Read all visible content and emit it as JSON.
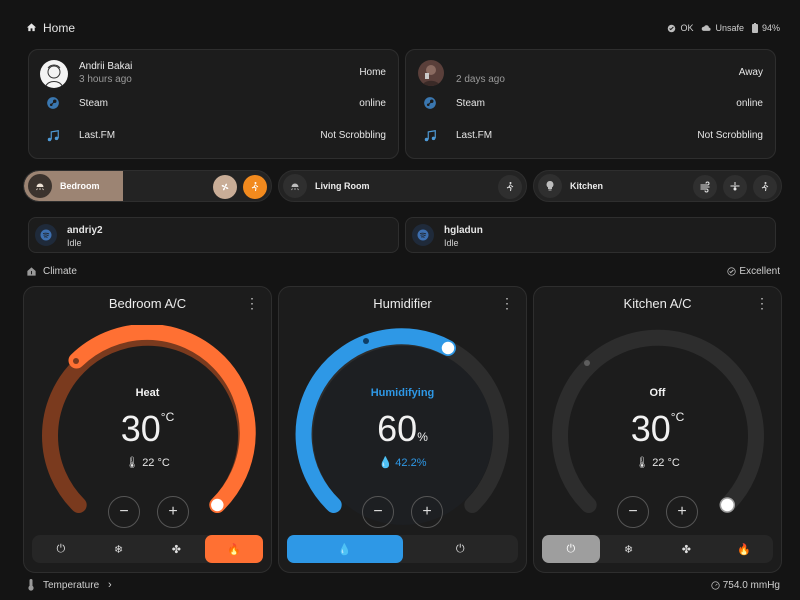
{
  "header": {
    "title": "Home",
    "status_ok": "OK",
    "status_unsafe": "Unsafe",
    "battery": "94%"
  },
  "users": [
    {
      "name": "Andrii Bakai",
      "time": "3 hours ago",
      "location": "Home",
      "steam_label": "Steam",
      "steam_status": "online",
      "lastfm_label": "Last.FM",
      "lastfm_status": "Not Scrobbling"
    },
    {
      "name": "",
      "time": "2 days ago",
      "location": "Away",
      "steam_label": "Steam",
      "steam_status": "online",
      "lastfm_label": "Last.FM",
      "lastfm_status": "Not Scrobbling"
    }
  ],
  "rooms": [
    {
      "label": "Bedroom",
      "brightness_fraction": 0.29,
      "icons": [
        "fan-icon",
        "motion-icon"
      ]
    },
    {
      "label": "Living Room",
      "icons": [
        "motion-icon"
      ]
    },
    {
      "label": "Kitchen",
      "icons": [
        "air-purifier-icon",
        "ceiling-fan-icon",
        "motion-icon"
      ]
    }
  ],
  "spotify": [
    {
      "user": "andriy2",
      "state": "Idle"
    },
    {
      "user": "hgladun",
      "state": "Idle"
    }
  ],
  "climate": {
    "section_label": "Climate",
    "status_label": "Excellent"
  },
  "thermostats": [
    {
      "title": "Bedroom A/C",
      "mode": "Heat",
      "value": "30",
      "unit": "°C",
      "current": "22 °C",
      "accent": "#ff7033",
      "level_fraction": 1.0,
      "active_mode_index": 3,
      "modes": [
        "power-icon",
        "snowflake-icon",
        "fan-icon",
        "flame-icon"
      ]
    },
    {
      "title": "Humidifier",
      "mode": "Humidifying",
      "value": "60",
      "unit": "%",
      "current": "42.2%",
      "accent": "#2e98e6",
      "level_fraction": 0.6,
      "active_mode_index": 0,
      "modes": [
        "water-drop-icon",
        "power-icon"
      ]
    },
    {
      "title": "Kitchen A/C",
      "mode": "Off",
      "value": "30",
      "unit": "°C",
      "current": "22 °C",
      "accent": "#9e9e9e",
      "level_fraction": 1.0,
      "active_mode_index": 0,
      "modes": [
        "power-icon",
        "snowflake-icon",
        "fan-icon",
        "flame-icon"
      ]
    }
  ],
  "footer": {
    "temperature_label": "Temperature",
    "pressure": "754.0 mmHg"
  }
}
